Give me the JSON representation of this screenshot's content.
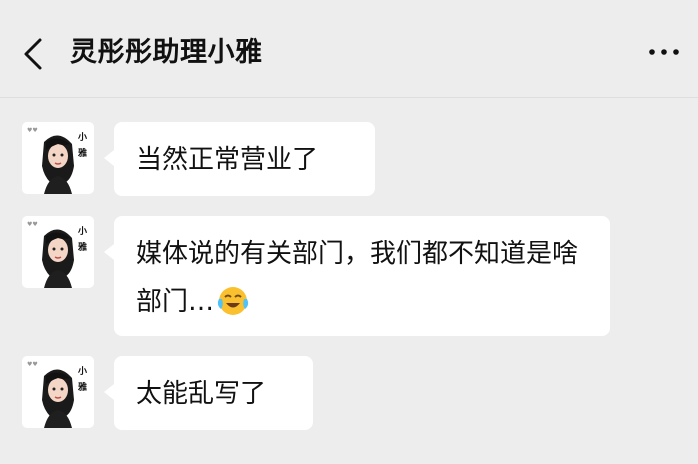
{
  "header": {
    "title": "灵彤彤助理小雅",
    "back_icon": "chevron-left-icon",
    "more_icon": "more-dots-icon"
  },
  "avatar": {
    "name_label": "小雅"
  },
  "messages": [
    {
      "text": "当然正常营业了"
    },
    {
      "text": "媒体说的有关部门，我们都不知道是啥部门…",
      "emoji": "face-with-tears-of-joy-icon"
    },
    {
      "text": "太能乱写了"
    }
  ],
  "colors": {
    "background": "#ededed",
    "bubble": "#ffffff",
    "text": "#111111"
  }
}
